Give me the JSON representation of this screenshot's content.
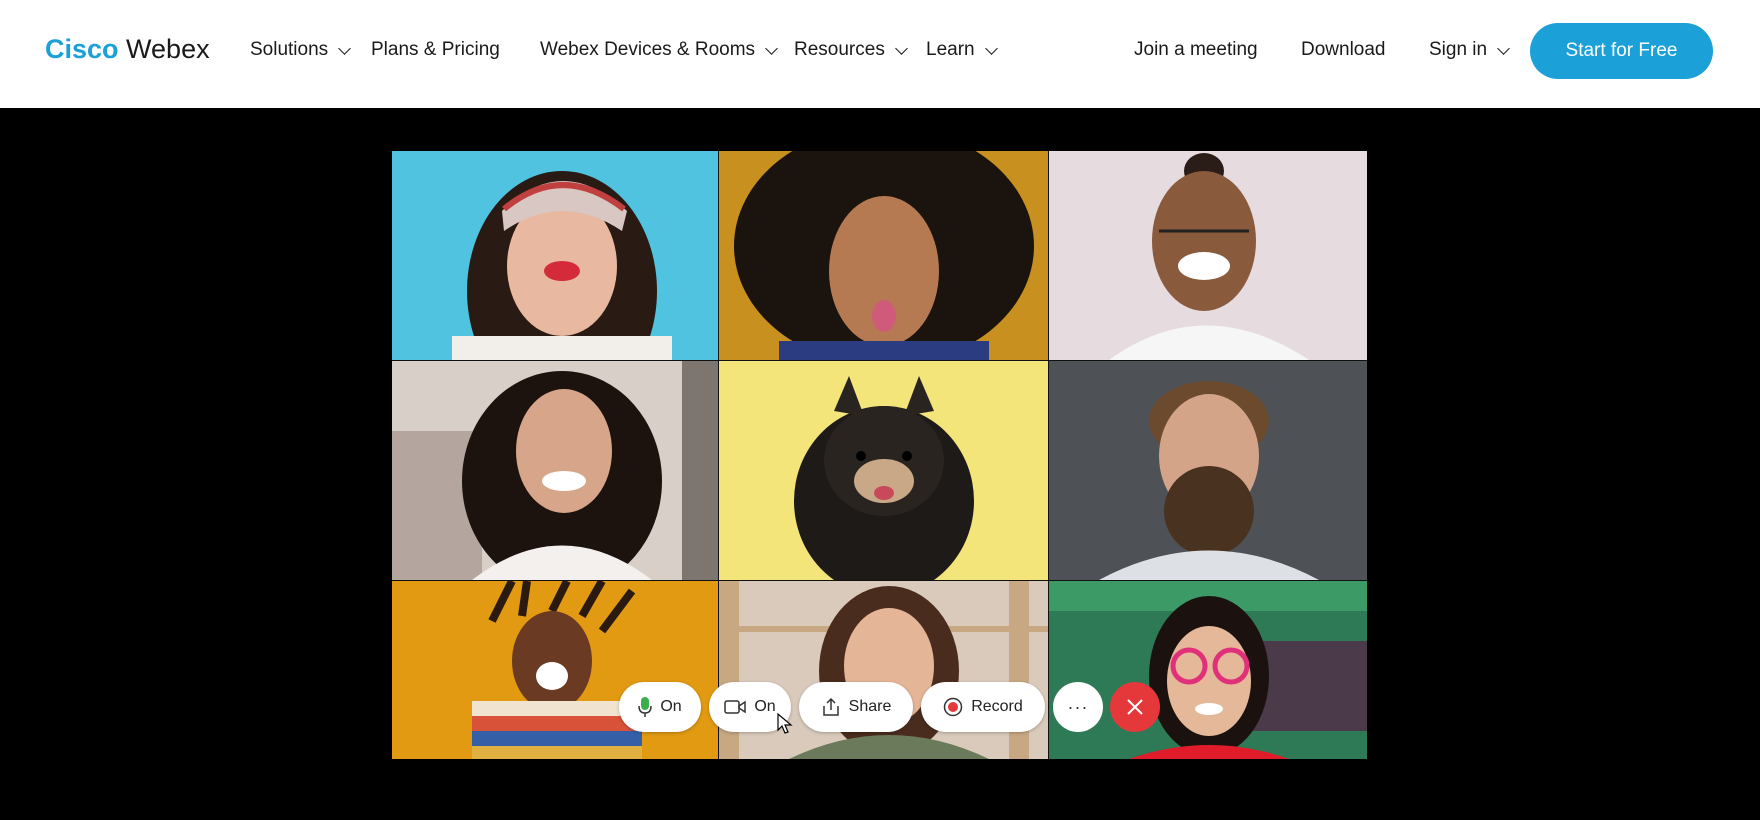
{
  "brand": {
    "cisco": "Cisco",
    "webex": "Webex"
  },
  "nav": {
    "solutions": "Solutions",
    "plans": "Plans & Pricing",
    "devices": "Webex Devices & Rooms",
    "resources": "Resources",
    "learn": "Learn",
    "join": "Join a meeting",
    "download": "Download",
    "signin": "Sign in",
    "cta": "Start for Free"
  },
  "meeting": {
    "mic_label": "On",
    "camera_label": "On",
    "share_label": "Share",
    "record_label": "Record",
    "more_label": "···"
  },
  "icons": {
    "mic": "microphone-icon",
    "camera": "camera-icon",
    "share": "share-icon",
    "record": "record-icon",
    "end": "close-icon"
  },
  "colors": {
    "accent": "#1ba0d7",
    "end_call": "#e5383b",
    "mic_green": "#3cae4c"
  }
}
